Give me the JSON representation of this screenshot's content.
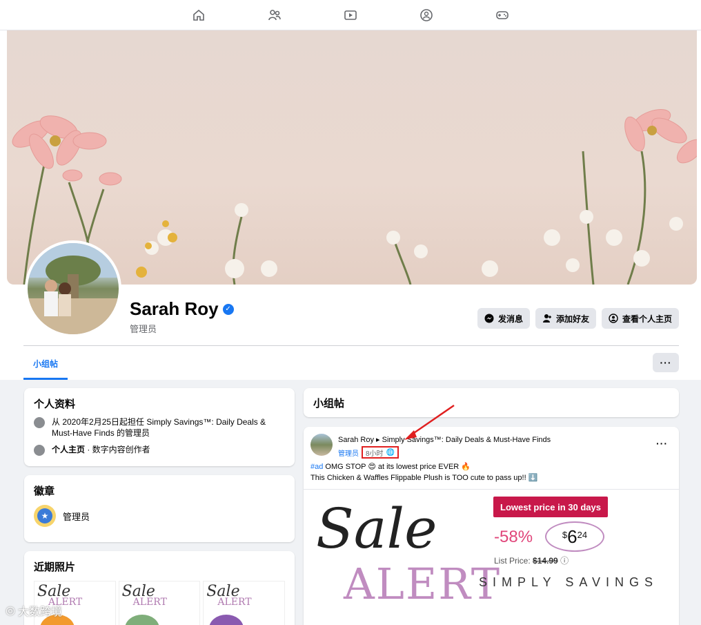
{
  "nav": {
    "icons": [
      "home-icon",
      "friends-icon",
      "video-icon",
      "groups-icon",
      "gaming-icon"
    ]
  },
  "profile": {
    "name": "Sarah Roy",
    "role": "管理员",
    "buttons": {
      "message": "发消息",
      "add_friend": "添加好友",
      "view_profile": "查看个人主页"
    },
    "tab": "小组帖",
    "more": "···"
  },
  "intro": {
    "title": "个人资料",
    "line1": "从 2020年2月25日起担任 Simply Savings™: Daily Deals & Must-Have Finds 的管理员",
    "line2_bold": "个人主页",
    "line2_rest": " · 数字内容创作者"
  },
  "badges": {
    "title": "徽章",
    "item": "管理员"
  },
  "photos": {
    "title": "近期照片",
    "items": [
      {
        "script": "Sale",
        "word": "ALERT"
      },
      {
        "script": "Sale",
        "word": "ALERT"
      },
      {
        "script": "Sale",
        "word": "ALERT"
      }
    ]
  },
  "group_posts": {
    "title": "小组帖"
  },
  "post": {
    "title": "Sarah Roy ▸ Simply Savings™: Daily Deals & Must-Have Finds",
    "admin": "管理员",
    "time": "8小时",
    "dots": "···",
    "hashtag": "#ad",
    "line1": " OMG STOP 😍 at its lowest price EVER 🔥",
    "line2": "This Chicken & Waffles Flippable Plush is TOO cute to pass up!! ⬇️"
  },
  "ad": {
    "script": "Sale",
    "word": "ALERT",
    "lowest": "Lowest price in 30 days",
    "discount": "-58%",
    "currency": "$",
    "price_main": "6",
    "price_cents": "24",
    "list_label": "List Price: ",
    "list_price": "$14.99",
    "brand": "SIMPLY SAVINGS"
  },
  "watermark": "大数跨境"
}
